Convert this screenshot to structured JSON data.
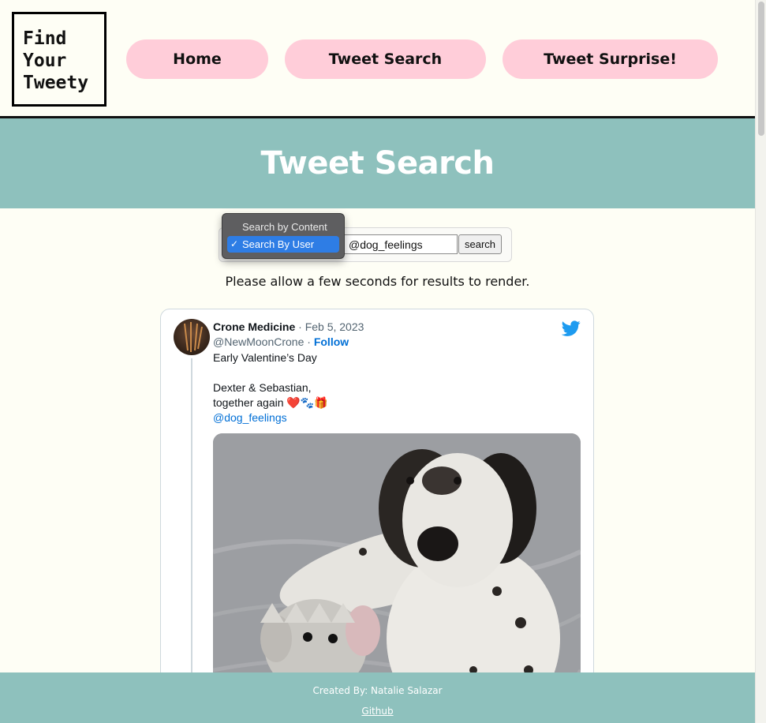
{
  "logo": {
    "text": "Find\nYour\nTweety"
  },
  "nav": {
    "home": "Home",
    "tweet_search": "Tweet Search",
    "tweet_surprise": "Tweet Surprise!"
  },
  "banner": {
    "title": "Tweet Search"
  },
  "search": {
    "options": [
      "Search by Content",
      "Search By User"
    ],
    "selected_index": 1,
    "input_value": "@dog_feelings",
    "button_label": "search"
  },
  "note": "Please allow a few seconds for results to render.",
  "tweet": {
    "name": "Crone Medicine",
    "date": " · Feb 5, 2023",
    "handle": "@NewMoonCrone",
    "separator": " · ",
    "follow": "Follow",
    "lines": [
      "Early Valentine’s Day",
      "",
      "Dexter & Sebastian,",
      "together again ❤️🐾🎁"
    ],
    "mention": "@dog_feelings"
  },
  "footer": {
    "credit": "Created By: Natalie Salazar",
    "link": "Github"
  },
  "colors": {
    "background": "#fefef5",
    "teal": "#8ec1bd",
    "pink": "#ffcdd9",
    "link_blue": "#006fd6",
    "twitter_blue": "#1d9bf0"
  }
}
